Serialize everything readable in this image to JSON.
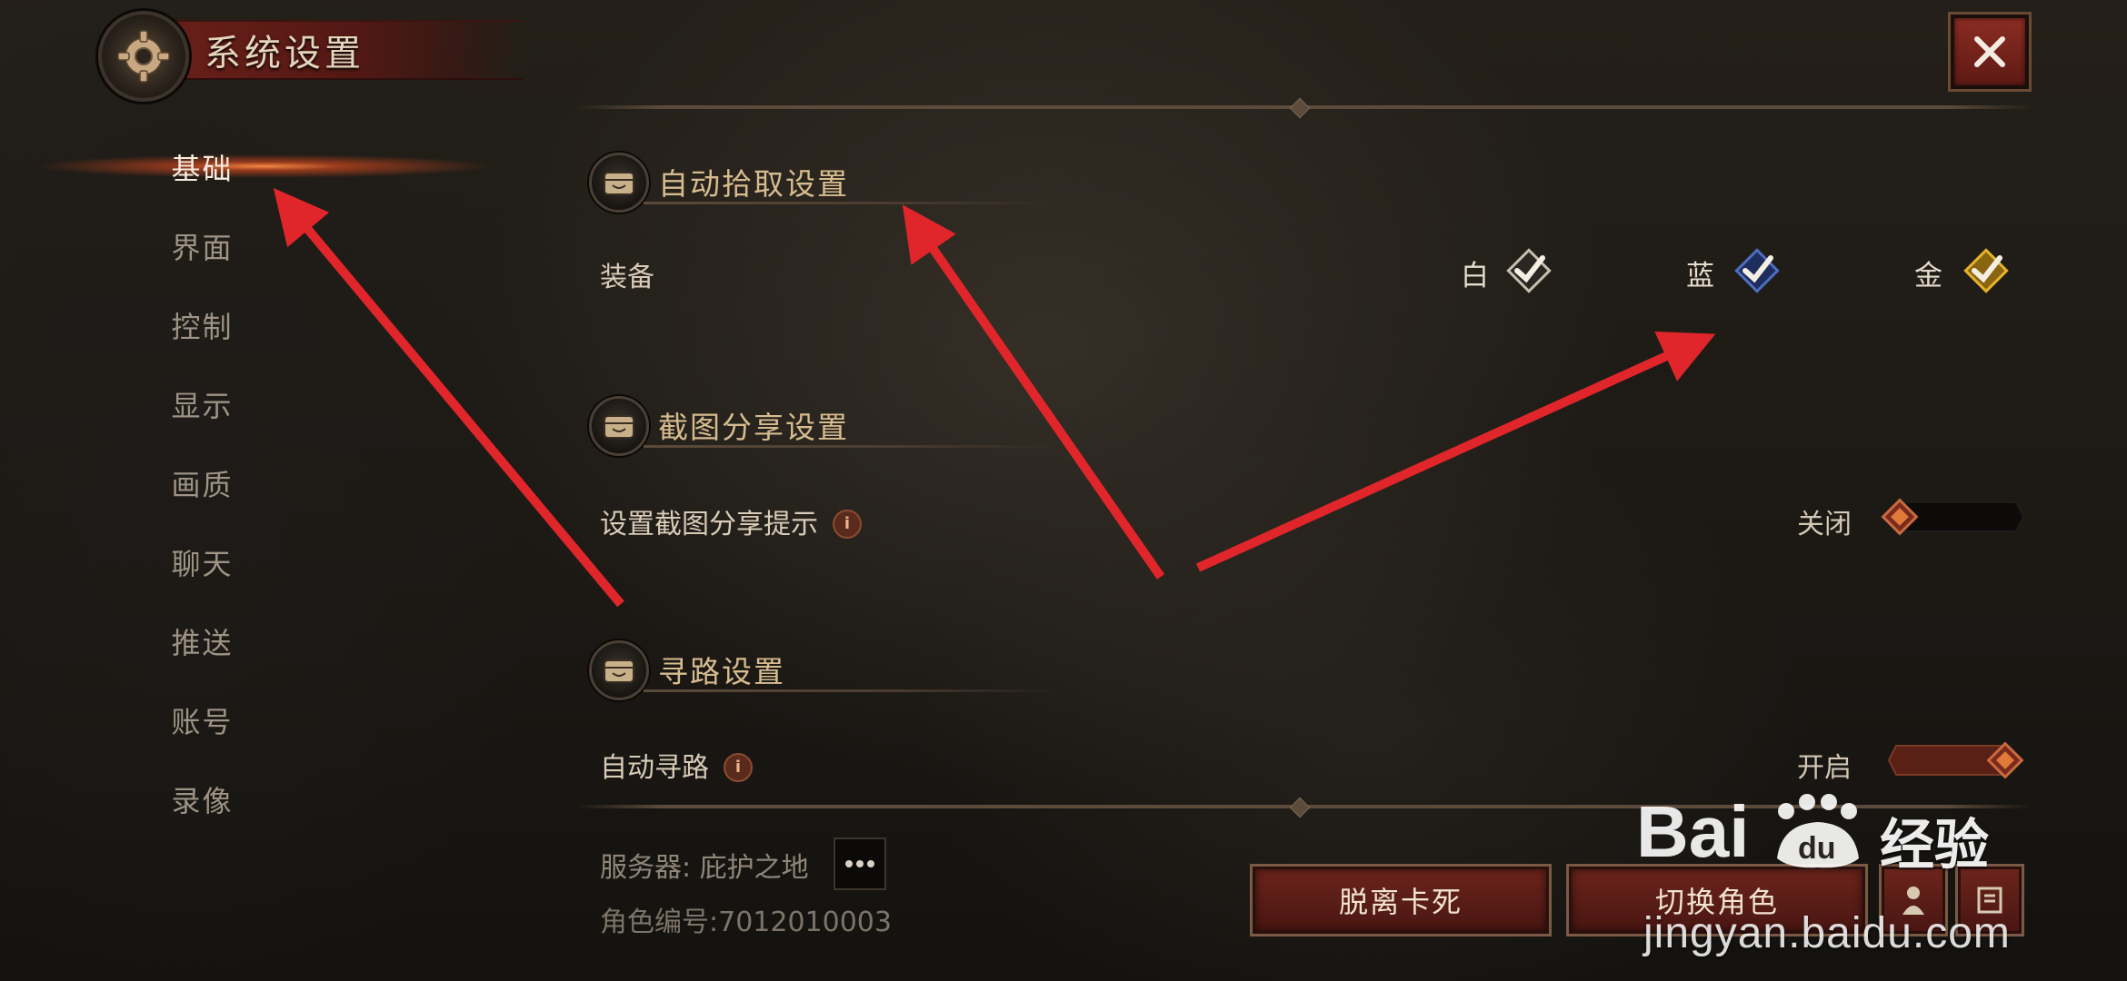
{
  "header": {
    "title": "系统设置",
    "close_icon": "close-icon"
  },
  "sidebar": {
    "items": [
      {
        "label": "基础",
        "active": true
      },
      {
        "label": "界面"
      },
      {
        "label": "控制"
      },
      {
        "label": "显示"
      },
      {
        "label": "画质"
      },
      {
        "label": "聊天"
      },
      {
        "label": "推送"
      },
      {
        "label": "账号"
      },
      {
        "label": "录像"
      }
    ]
  },
  "sections": {
    "auto_pickup": {
      "title": "自动拾取设置",
      "row_label": "装备",
      "options": [
        {
          "label": "白",
          "checked": true,
          "color": "#e8e0cc"
        },
        {
          "label": "蓝",
          "checked": true,
          "color": "#2b4a93"
        },
        {
          "label": "金",
          "checked": true,
          "color": "#d9a21c"
        }
      ]
    },
    "screenshot_share": {
      "title": "截图分享设置",
      "row_label": "设置截图分享提示",
      "state": "关闭",
      "enabled": false
    },
    "pathfinding": {
      "title": "寻路设置",
      "row_label": "自动寻路",
      "state": "开启",
      "enabled": true
    }
  },
  "footer": {
    "server": "服务器: 庇护之地",
    "role_id": "角色编号:7012010003",
    "unstuck_button": "脱离卡死",
    "switch_role_button": "切换角色"
  },
  "watermark": {
    "brand": "Bai du 经验",
    "jingyan": "经验",
    "url": "jingyan.baidu.com"
  },
  "colors": {
    "accent_red": "#6b241c",
    "gold_text": "#d7bc8f",
    "annotation_arrow": "#e0262a"
  }
}
